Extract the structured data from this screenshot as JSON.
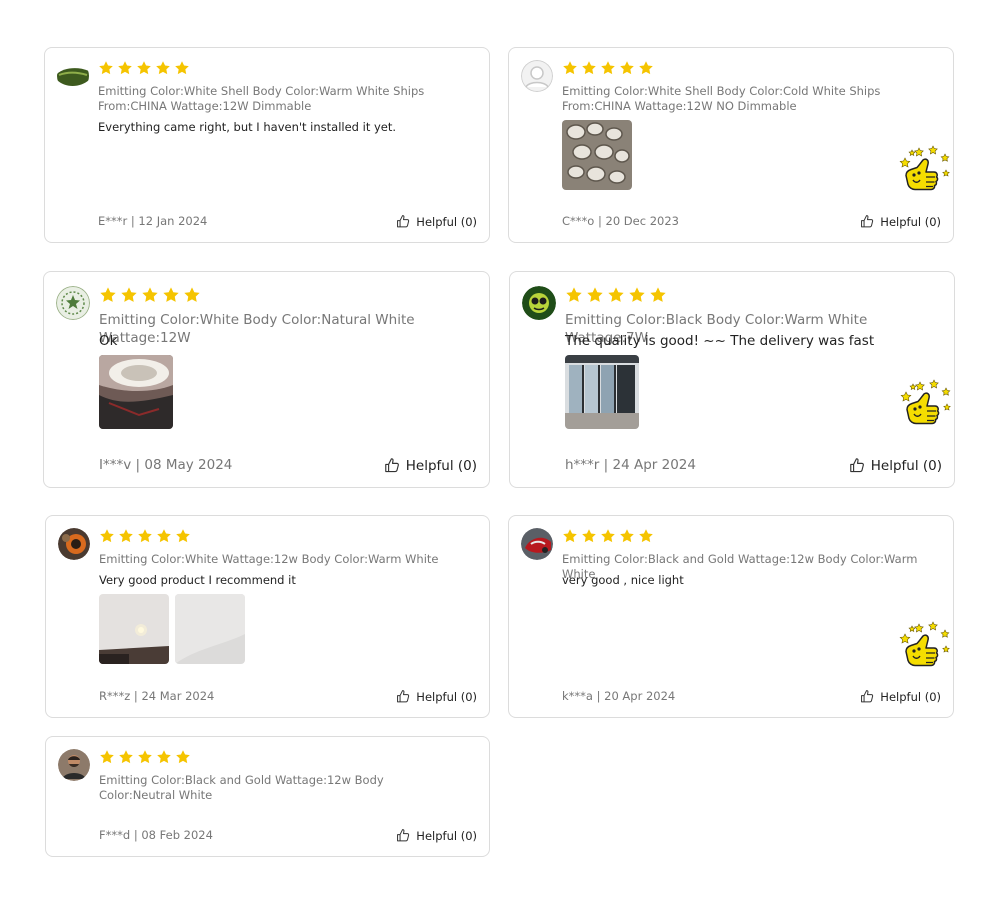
{
  "helpful_label": "Helpful (0)",
  "reviews": [
    {
      "meta": "Emitting Color:White Shell Body Color:Warm White Ships From:CHINA Wattage:12W Dimmable",
      "text": "Everything came right, but I haven't installed it yet.",
      "author_date": "E***r | 12 Jan 2024",
      "rating": 5
    },
    {
      "meta": "Emitting Color:White Shell Body Color:Cold White Ships From:CHINA Wattage:12W NO Dimmable",
      "text": "",
      "author_date": "C***o | 20 Dec 2023",
      "rating": 5
    },
    {
      "meta": "Emitting Color:White Body Color:Natural White Wattage:12W",
      "text": "Ok",
      "author_date": "I***v | 08 May 2024",
      "rating": 5
    },
    {
      "meta": "Emitting Color:Black Body Color:Warm White Wattage:7W",
      "text": "The quality is good! ~~ The delivery was fast",
      "author_date": "h***r | 24 Apr 2024",
      "rating": 5
    },
    {
      "meta": "Emitting Color:White Wattage:12w Body Color:Warm White",
      "text": "Very good product I recommend it",
      "author_date": "R***z | 24 Mar 2024",
      "rating": 5
    },
    {
      "meta": "Emitting Color:Black and Gold Wattage:12w Body Color:Warm White",
      "text": "very good , nice light",
      "author_date": "k***a | 20 Apr 2024",
      "rating": 5
    },
    {
      "meta": "Emitting Color:Black and Gold Wattage:12w Body Color:Neutral White",
      "text": "",
      "author_date": "F***d | 08 Feb 2024",
      "rating": 5
    }
  ],
  "colors": {
    "star": "#F5C400",
    "border": "#dcdcdc",
    "meta": "#777777"
  }
}
